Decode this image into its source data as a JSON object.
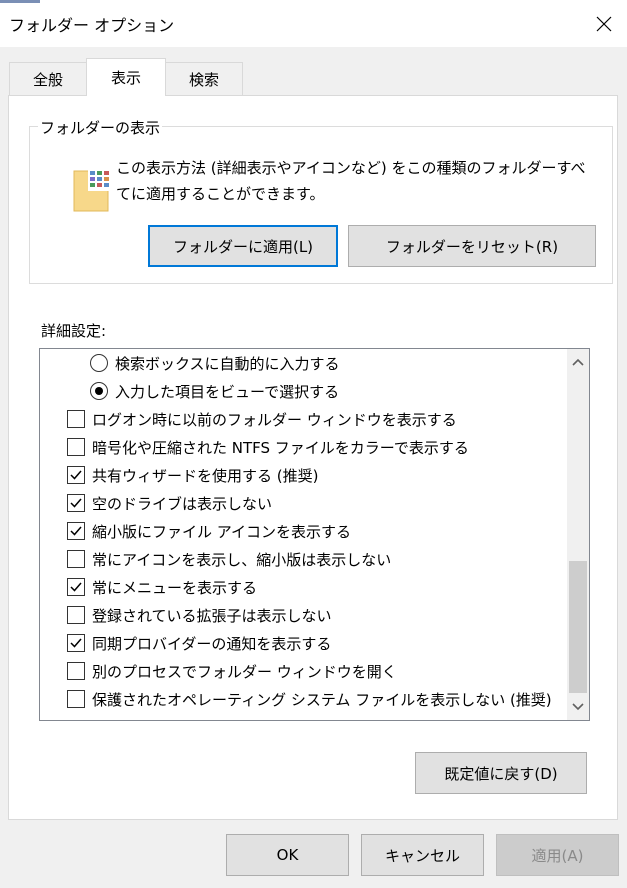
{
  "window": {
    "title": "フォルダー オプション"
  },
  "tabs": [
    {
      "label": "全般"
    },
    {
      "label": "表示"
    },
    {
      "label": "検索"
    }
  ],
  "folder_view": {
    "group_label": "フォルダーの表示",
    "description": "この表示方法 (詳細表示やアイコンなど) をこの種類のフォルダーすべてに適用することができます。",
    "apply_button": "フォルダーに適用(L)",
    "reset_button": "フォルダーをリセット(R)"
  },
  "advanced": {
    "label": "詳細設定:",
    "items": [
      {
        "type": "radio",
        "checked": false,
        "label": "検索ボックスに自動的に入力する"
      },
      {
        "type": "radio",
        "checked": true,
        "label": "入力した項目をビューで選択する"
      },
      {
        "type": "checkbox",
        "checked": false,
        "label": "ログオン時に以前のフォルダー ウィンドウを表示する"
      },
      {
        "type": "checkbox",
        "checked": false,
        "label": "暗号化や圧縮された NTFS ファイルをカラーで表示する"
      },
      {
        "type": "checkbox",
        "checked": true,
        "label": "共有ウィザードを使用する (推奨)"
      },
      {
        "type": "checkbox",
        "checked": true,
        "label": "空のドライブは表示しない"
      },
      {
        "type": "checkbox",
        "checked": true,
        "label": "縮小版にファイル アイコンを表示する"
      },
      {
        "type": "checkbox",
        "checked": false,
        "label": "常にアイコンを表示し、縮小版は表示しない"
      },
      {
        "type": "checkbox",
        "checked": true,
        "label": "常にメニューを表示する"
      },
      {
        "type": "checkbox",
        "checked": false,
        "label": "登録されている拡張子は表示しない"
      },
      {
        "type": "checkbox",
        "checked": true,
        "label": "同期プロバイダーの通知を表示する"
      },
      {
        "type": "checkbox",
        "checked": false,
        "label": "別のプロセスでフォルダー ウィンドウを開く"
      },
      {
        "type": "checkbox",
        "checked": false,
        "label": "保護されたオペレーティング システム ファイルを表示しない (推奨)"
      }
    ],
    "restore_defaults_button": "既定値に戻す(D)"
  },
  "footer": {
    "ok_button": "OK",
    "cancel_button": "キャンセル",
    "apply_button": "適用(A)"
  },
  "colors": {
    "focus_border": "#0078d7",
    "panel_bg": "#ffffff",
    "dialog_bg": "#f0f0f0"
  }
}
